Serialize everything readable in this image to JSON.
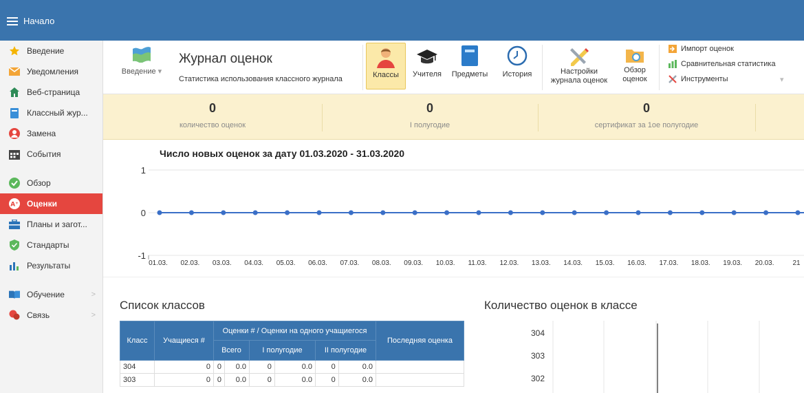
{
  "topbar": {
    "menu_label": "Начало"
  },
  "sidebar": {
    "items": [
      {
        "label": "Введение",
        "icon": "star-icon"
      },
      {
        "label": "Уведомления",
        "icon": "envelope-icon"
      },
      {
        "label": "Веб-страница",
        "icon": "home-icon"
      },
      {
        "label": "Классный жур...",
        "icon": "book-icon"
      },
      {
        "label": "Замена",
        "icon": "person-icon"
      },
      {
        "label": "События",
        "icon": "calendar-icon"
      },
      {
        "label": "Обзор",
        "icon": "check-circle-icon"
      },
      {
        "label": "Оценки",
        "icon": "grades-icon"
      },
      {
        "label": "Планы и загот...",
        "icon": "briefcase-icon"
      },
      {
        "label": "Стандарты",
        "icon": "shield-icon"
      },
      {
        "label": "Результаты",
        "icon": "bar-chart-icon"
      },
      {
        "label": "Обучение",
        "icon": "open-book-icon"
      },
      {
        "label": "Связь",
        "icon": "chat-icon"
      }
    ]
  },
  "ribbon": {
    "intro_label": "Введение",
    "title": "Журнал оценок",
    "subtitle": "Статистика использования классного журнала",
    "buttons": {
      "classes": "Классы",
      "teachers": "Учителя",
      "subjects": "Предметы",
      "history": "История",
      "settings_l1": "Настройки",
      "settings_l2": "журнала оценок",
      "overview_l1": "Обзор",
      "overview_l2": "оценок"
    },
    "tools": {
      "import": "Импорт оценок",
      "compare": "Сравнительная статистика",
      "instruments": "Инструменты"
    }
  },
  "stats": [
    {
      "value": "0",
      "label": "количество оценок"
    },
    {
      "value": "0",
      "label": "I полугодие"
    },
    {
      "value": "0",
      "label": "сертификат за 1ое полугодие"
    }
  ],
  "chart_data": {
    "type": "line",
    "title": "Число новых оценок за дату 01.03.2020 - 31.03.2020",
    "x": [
      "01.03.",
      "02.03.",
      "03.03.",
      "04.03.",
      "05.03.",
      "06.03.",
      "07.03.",
      "08.03.",
      "09.03.",
      "10.03.",
      "11.03.",
      "12.03.",
      "13.03.",
      "14.03.",
      "15.03.",
      "16.03.",
      "17.03.",
      "18.03.",
      "19.03.",
      "20.03.",
      "21"
    ],
    "series": [
      {
        "values": [
          0,
          0,
          0,
          0,
          0,
          0,
          0,
          0,
          0,
          0,
          0,
          0,
          0,
          0,
          0,
          0,
          0,
          0,
          0,
          0,
          0
        ]
      }
    ],
    "ylim": [
      -1,
      1
    ],
    "yticks": [
      "1",
      "0",
      "-1"
    ],
    "color": "#3a6fc7"
  },
  "classes_list": {
    "title": "Список классов",
    "headers": {
      "class": "Класс",
      "students": "Учащиеся #",
      "grades": "Оценки # / Оценки на одного учащиегося",
      "total": "Всего",
      "half1": "I полугодие",
      "half2": "II полугодие",
      "last": "Последняя оценка"
    },
    "rows": [
      {
        "cls": "304",
        "students": "0",
        "t1": "0",
        "t2": "0.0",
        "h1a": "0",
        "h1b": "0.0",
        "h2a": "0",
        "h2b": "0.0",
        "last": ""
      },
      {
        "cls": "303",
        "students": "0",
        "t1": "0",
        "t2": "0.0",
        "h1a": "0",
        "h1b": "0.0",
        "h2a": "0",
        "h2b": "0.0",
        "last": ""
      }
    ]
  },
  "class_counts": {
    "title": "Количество оценок в классе",
    "categories": [
      "304",
      "303",
      "302"
    ]
  }
}
